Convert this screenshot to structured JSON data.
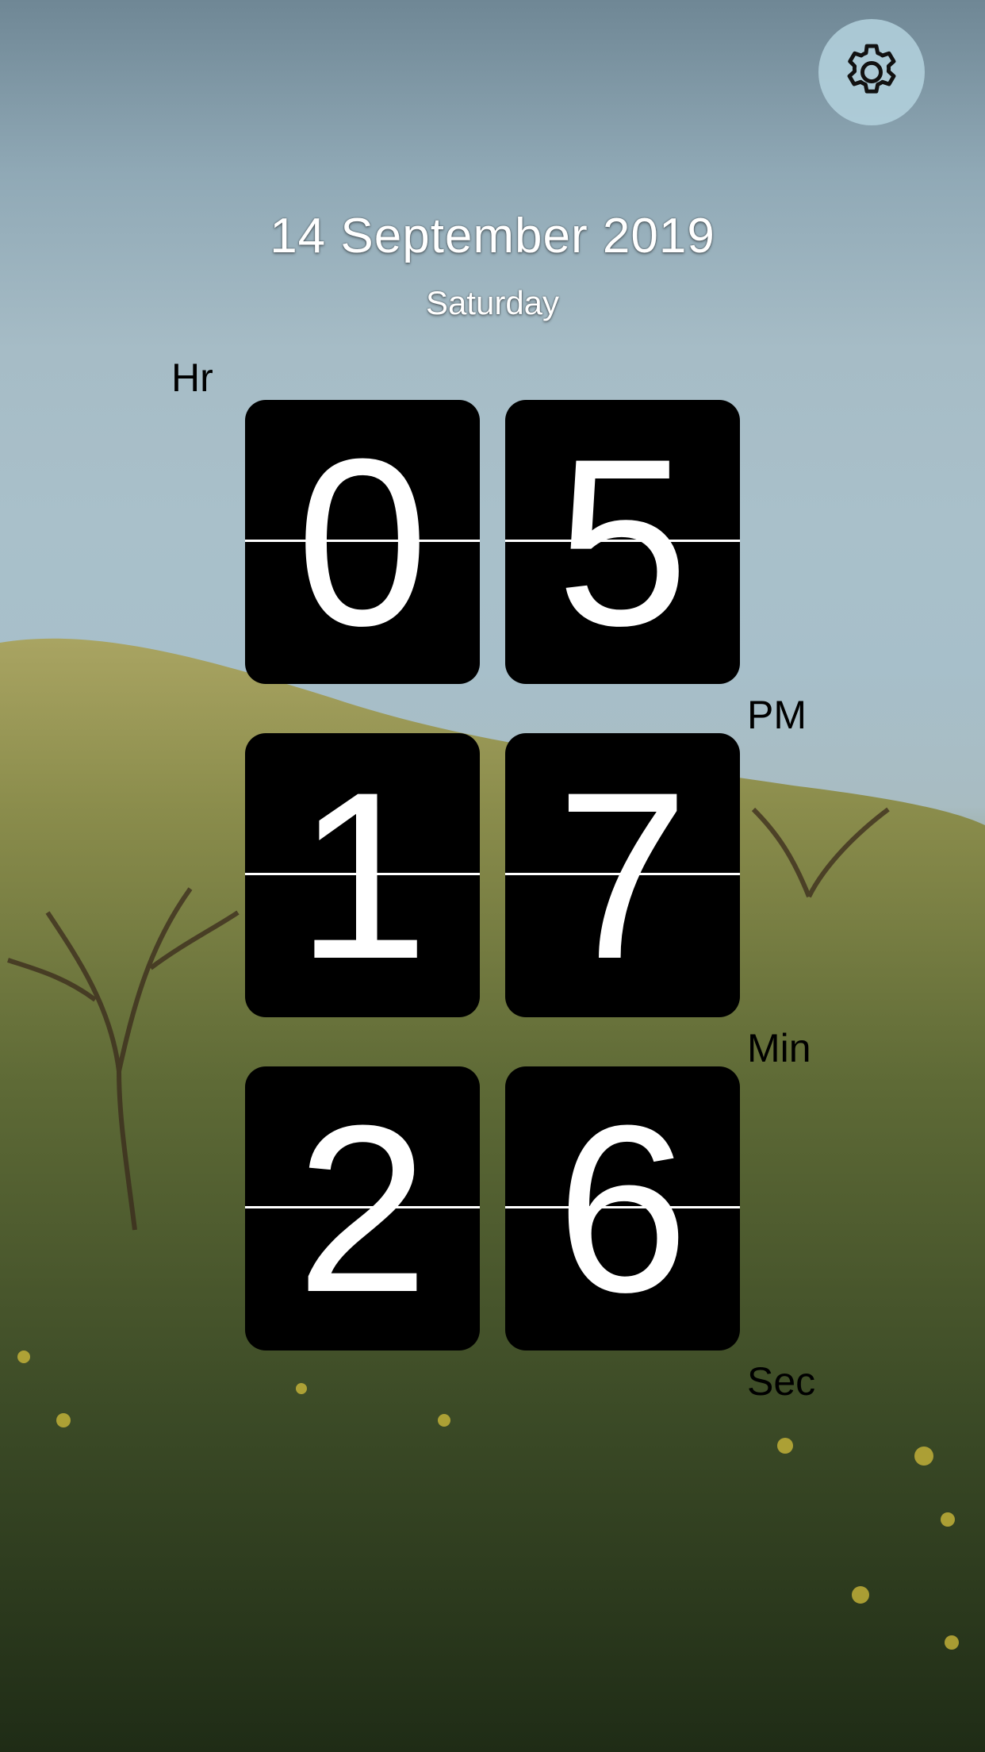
{
  "date": {
    "full": "14 September 2019",
    "weekday": "Saturday"
  },
  "labels": {
    "hour": "Hr",
    "period": "PM",
    "minute": "Min",
    "second": "Sec"
  },
  "clock": {
    "hour_tens": "0",
    "hour_ones": "5",
    "minute_tens": "1",
    "minute_ones": "7",
    "second_tens": "2",
    "second_ones": "6"
  },
  "icons": {
    "settings": "gear-icon"
  },
  "colors": {
    "tile_background": "#000000",
    "digit": "#ffffff",
    "settings_button_bg": "#b4d2de"
  }
}
